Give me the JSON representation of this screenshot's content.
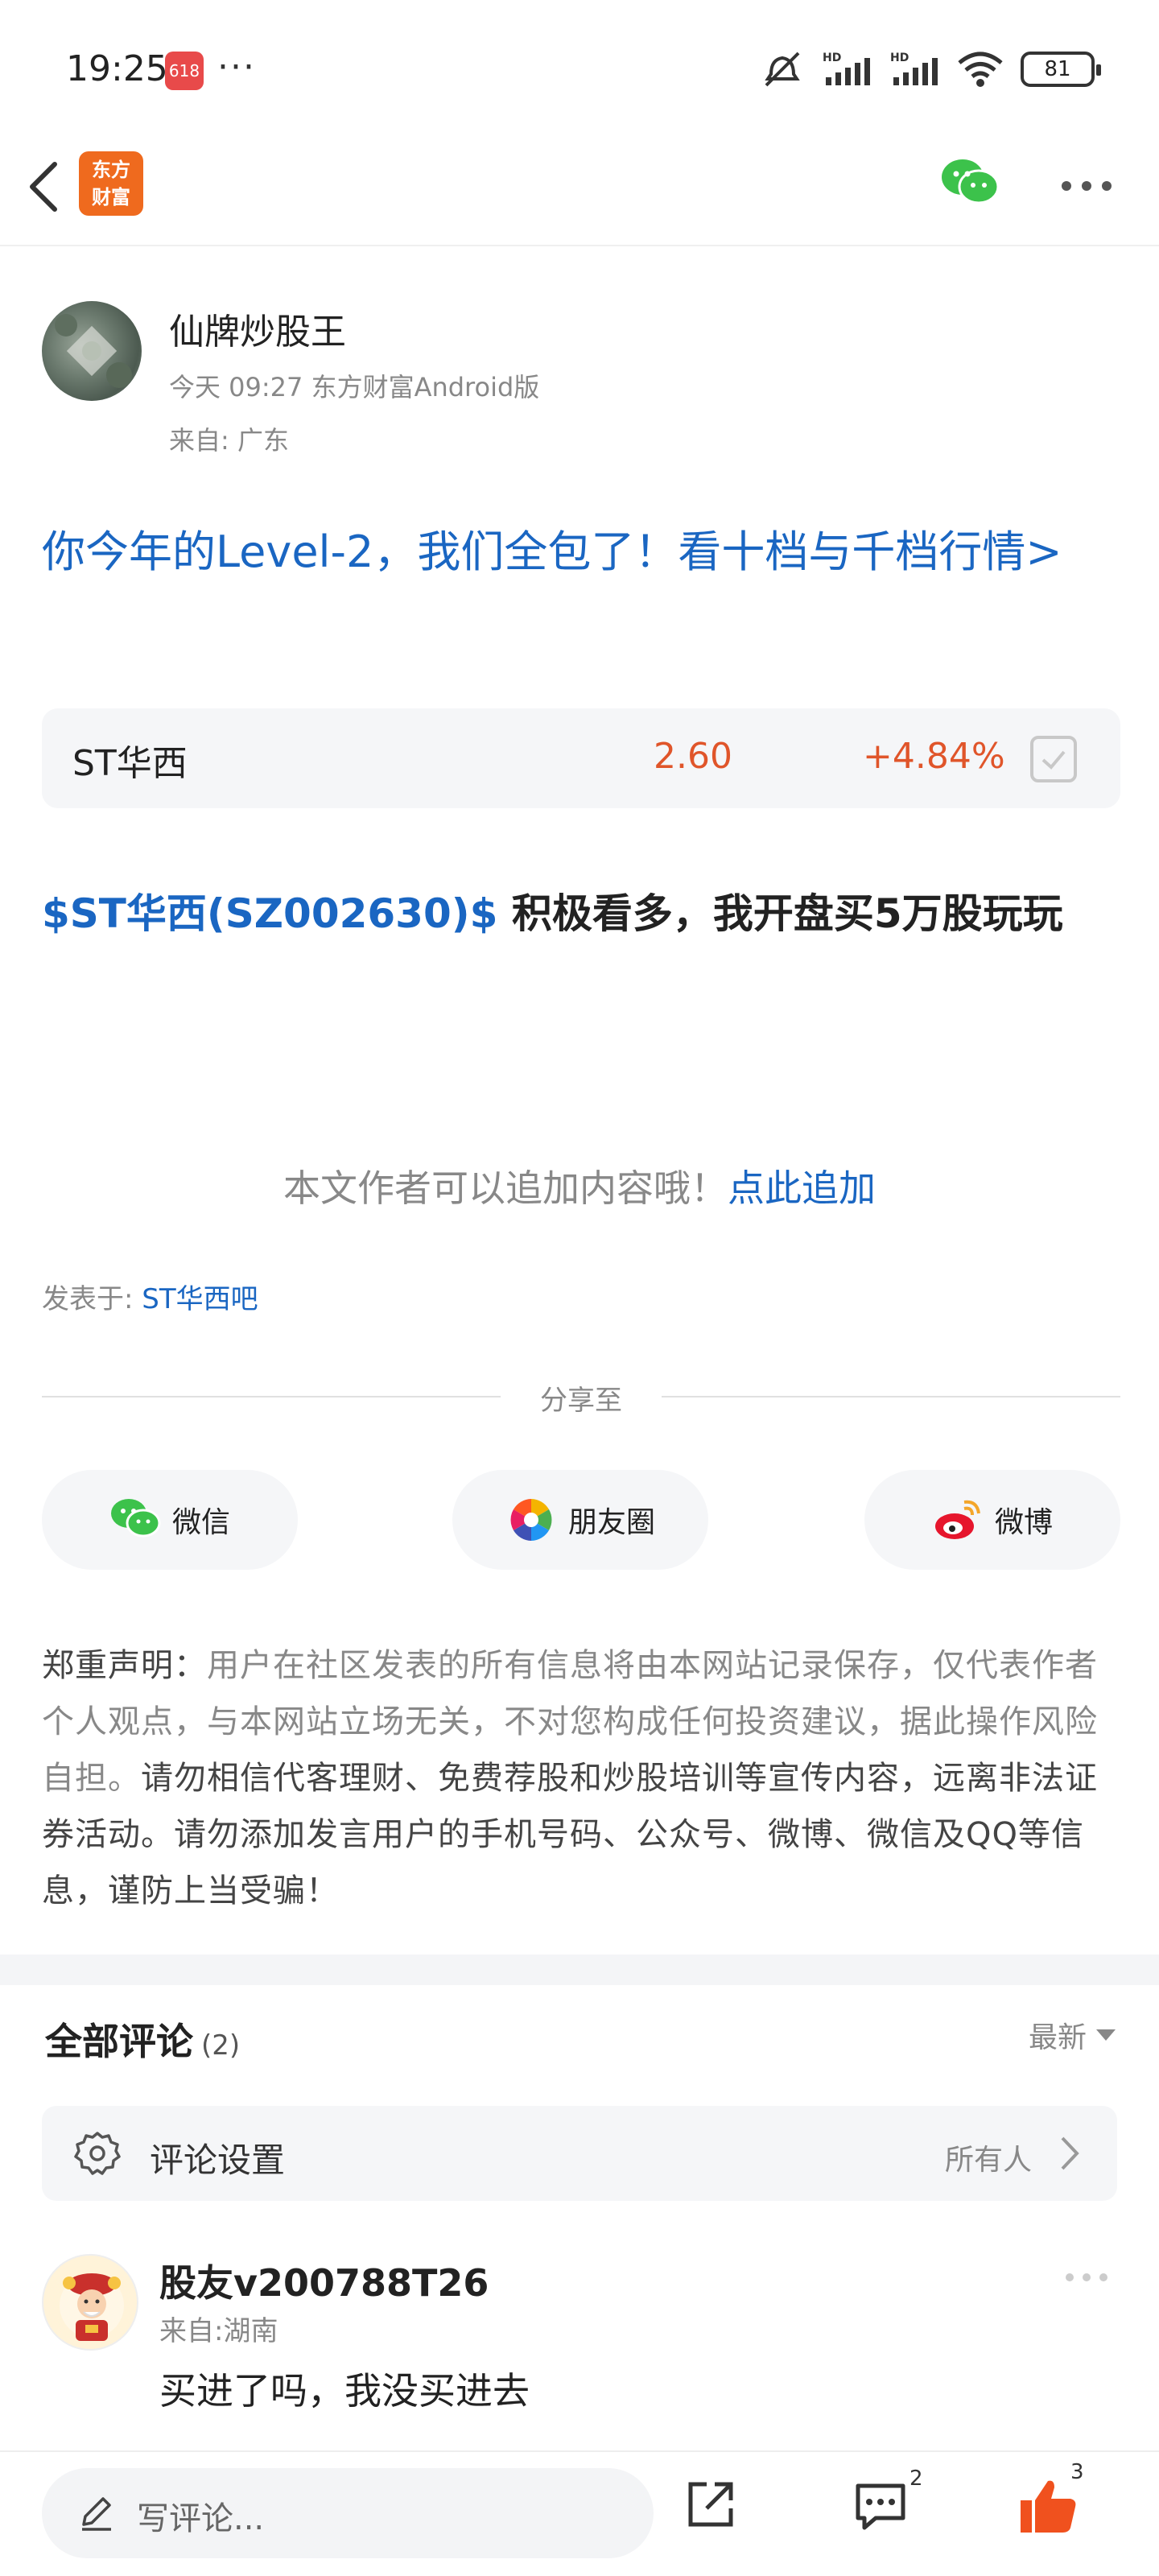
{
  "status_bar": {
    "time": "19:25",
    "app_badge": "618",
    "more": "···",
    "battery": "81"
  },
  "nav": {
    "logo_text_line1": "东方",
    "logo_text_line2": "财富"
  },
  "author": {
    "name": "仙牌炒股王",
    "meta": "今天 09:27 东方财富Android版",
    "location": "来自: 广东"
  },
  "promo": {
    "text": "你今年的Level-2，我们全包了！看十档与千档行情>"
  },
  "stock_card": {
    "name": "ST华西",
    "price": "2.60",
    "change": "+4.84%"
  },
  "post": {
    "stock_tag": "$ST华西(SZ002630)$",
    "text": " 积极看多，我开盘买5万股玩玩"
  },
  "append": {
    "prefix": "本文作者可以追加内容哦！",
    "link": "点此追加"
  },
  "posted_in": {
    "label": "发表于: ",
    "bar": "ST华西吧"
  },
  "share": {
    "label": "分享至",
    "wechat": "微信",
    "moments": "朋友圈",
    "weibo": "微博"
  },
  "disclaimer": {
    "title": "郑重声明：",
    "part1": "用户在社区发表的所有信息将由本网站记录保存，仅代表作者个人观点，与本网站立场无关，不对您构成任何投资建议，据此操作风险自担。",
    "part2": "请勿相信代客理财、免费荐股和炒股培训等宣传内容，远离非法证券活动。请勿添加发言用户的手机号码、公众号、微博、微信及QQ等信息，谨防上当受骗！"
  },
  "comments": {
    "title": "全部评论",
    "count": "(2)",
    "sort": "最新",
    "settings_label": "评论设置",
    "settings_value": "所有人",
    "items": [
      {
        "user": "股友v200788T26",
        "location": "来自:湖南",
        "text": "买进了吗，我没买进去"
      }
    ]
  },
  "bottom_bar": {
    "input_placeholder": "写评论...",
    "comment_count": "2",
    "like_count": "3"
  },
  "colors": {
    "link_blue": "#1a66c2",
    "price_red": "#e0552a",
    "brand_orange": "#ef6a1e",
    "like_orange": "#f0511e"
  }
}
